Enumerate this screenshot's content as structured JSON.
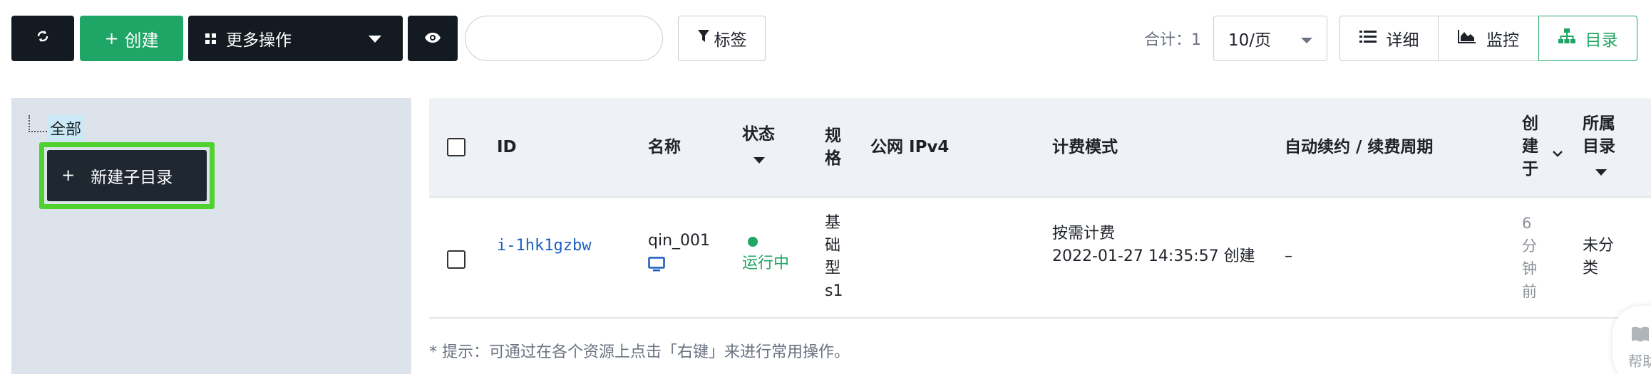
{
  "toolbar": {
    "create_label": "创建",
    "more_actions_label": "更多操作",
    "search_placeholder": "",
    "tag_label": "标签",
    "total_label": "合计：1",
    "page_size": "10/页"
  },
  "view_buttons": [
    {
      "label": "详细",
      "icon": "list-icon",
      "active": false
    },
    {
      "label": "监控",
      "icon": "chart-area-icon",
      "active": false
    },
    {
      "label": "目录",
      "icon": "sitemap-icon",
      "active": true
    }
  ],
  "tree": {
    "root_label": "全部",
    "context_menu_item": "新建子目录"
  },
  "table": {
    "headers": {
      "id": "ID",
      "name": "名称",
      "status": "状态",
      "spec": "规格",
      "ipv4": "公网 IPv4",
      "billing": "计费模式",
      "renew": "自动续约 / 续费周期",
      "created": "创建于",
      "directory": "所属目录"
    },
    "rows": [
      {
        "id": "i-1hk1gzbw",
        "name": "qin_001",
        "name_icon": "monitor-icon",
        "status": "运行中",
        "spec": "基础型s1",
        "ipv4": "",
        "billing_mode": "按需计费",
        "billing_time": "2022-01-27 14:35:57 创建",
        "renew": "–",
        "created": "6分钟前",
        "directory": "未分类"
      }
    ]
  },
  "tip": "* 提示：可通过在各个资源上点击「右键」来进行常用操作。",
  "help_label": "帮助",
  "colors": {
    "accent_green": "#1fa565",
    "highlight_green": "#4fd12f",
    "dark_button": "#141a22",
    "link_blue": "#1c5fc2"
  }
}
